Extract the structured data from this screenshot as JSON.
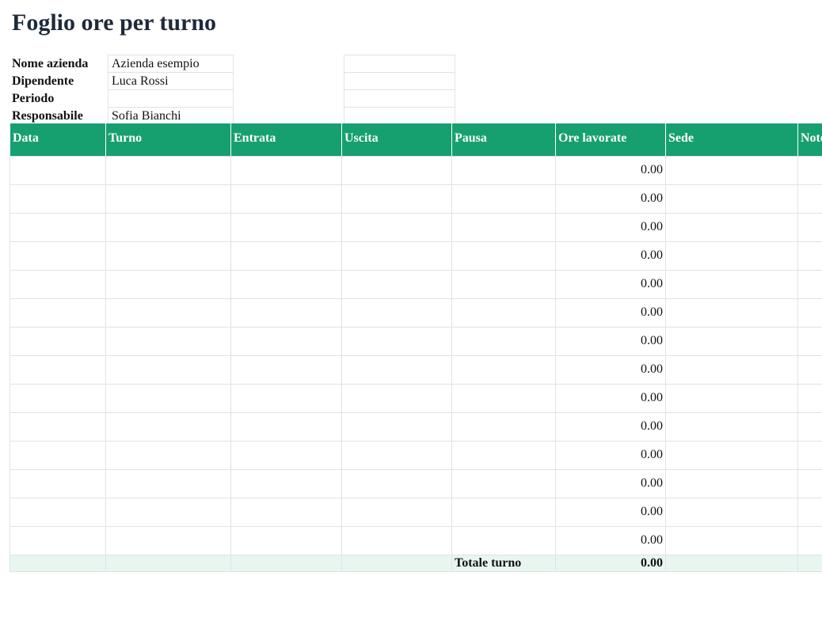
{
  "title": "Foglio ore per turno",
  "info": {
    "rows": [
      {
        "label": "Nome azienda",
        "value": "Azienda esempio"
      },
      {
        "label": "Dipendente",
        "value": "Luca Rossi"
      },
      {
        "label": "Periodo",
        "value": ""
      },
      {
        "label": "Responsabile",
        "value": "Sofia Bianchi"
      }
    ]
  },
  "table": {
    "columns": [
      "Data",
      "Turno",
      "Entrata",
      "Uscita",
      "Pausa",
      "Ore lavorate",
      "Sede",
      "Note"
    ],
    "rows": [
      {
        "ore_lavorate": "0.00"
      },
      {
        "ore_lavorate": "0.00"
      },
      {
        "ore_lavorate": "0.00"
      },
      {
        "ore_lavorate": "0.00"
      },
      {
        "ore_lavorate": "0.00"
      },
      {
        "ore_lavorate": "0.00"
      },
      {
        "ore_lavorate": "0.00"
      },
      {
        "ore_lavorate": "0.00"
      },
      {
        "ore_lavorate": "0.00"
      },
      {
        "ore_lavorate": "0.00"
      },
      {
        "ore_lavorate": "0.00"
      },
      {
        "ore_lavorate": "0.00"
      },
      {
        "ore_lavorate": "0.00"
      },
      {
        "ore_lavorate": "0.00"
      }
    ],
    "total_label": "Totale turno",
    "total_value": "0.00"
  },
  "colors": {
    "header_bg": "#16a06f",
    "total_bg": "#e9f6ef",
    "title": "#1e2a3a"
  }
}
